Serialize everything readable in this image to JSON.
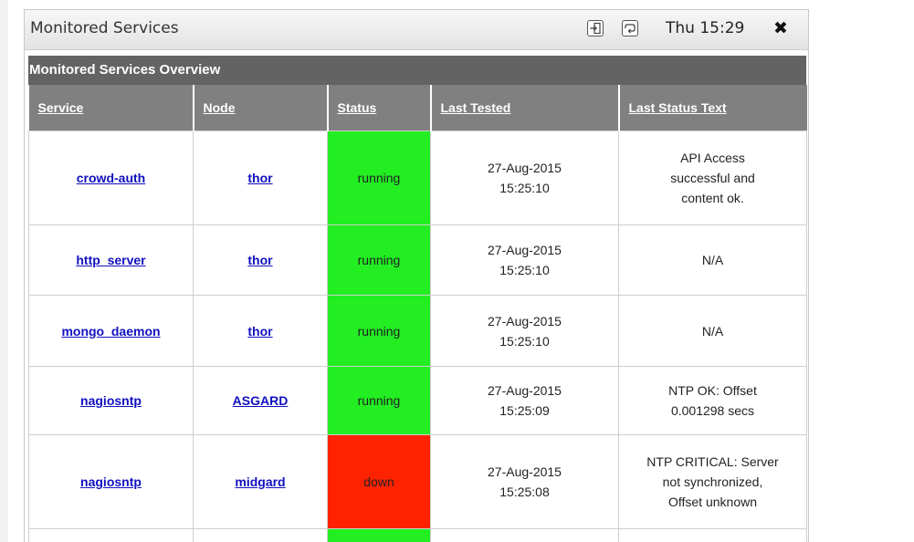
{
  "window": {
    "title": "Monitored Services",
    "clock": "Thu 15:29",
    "close_label": "✖"
  },
  "panel": {
    "header": "Monitored Services Overview"
  },
  "table": {
    "columns": [
      "Service",
      "Node",
      "Status",
      "Last Tested",
      "Last Status Text"
    ],
    "rows": [
      {
        "service": "crowd-auth",
        "node": "thor",
        "status": "running",
        "date": "27-Aug-2015",
        "time": "15:25:10",
        "text": [
          "API Access",
          "successful and",
          "content ok."
        ]
      },
      {
        "service": "http_server",
        "node": "thor",
        "status": "running",
        "date": "27-Aug-2015",
        "time": "15:25:10",
        "text": [
          "N/A"
        ]
      },
      {
        "service": "mongo_daemon",
        "node": "thor",
        "status": "running",
        "date": "27-Aug-2015",
        "time": "15:25:10",
        "text": [
          "N/A"
        ]
      },
      {
        "service": "nagiosntp",
        "node": "ASGARD",
        "status": "running",
        "date": "27-Aug-2015",
        "time": "15:25:09",
        "text": [
          "NTP OK: Offset",
          "0.001298 secs"
        ]
      },
      {
        "service": "nagiosntp",
        "node": "midgard",
        "status": "down",
        "date": "27-Aug-2015",
        "time": "15:25:08",
        "text": [
          "NTP CRITICAL: Server",
          "not synchronized,",
          "Offset unknown"
        ]
      }
    ]
  },
  "colors": {
    "running": "#22ee22",
    "down": "#ff2200",
    "header_bg": "#636363",
    "column_header_bg": "#808080",
    "link": "#1010c0"
  },
  "icons": {
    "export": "export-icon",
    "refresh": "refresh-icon",
    "close": "close-icon"
  }
}
